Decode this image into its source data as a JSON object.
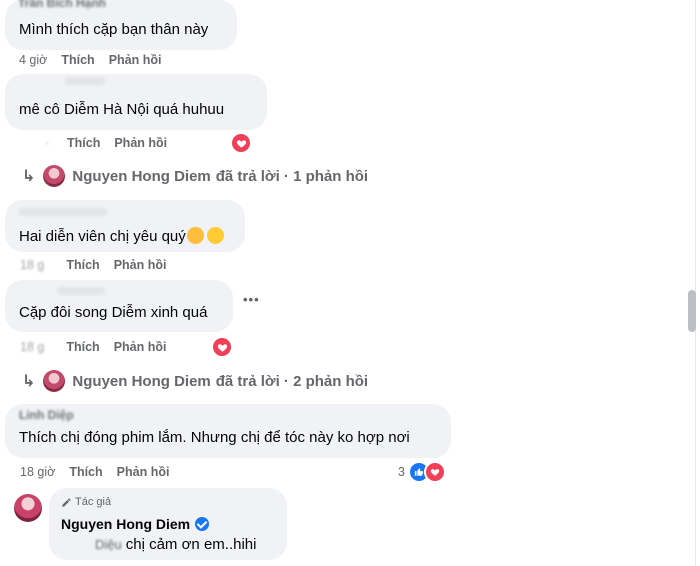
{
  "comments": [
    {
      "name": "Trần Bích Hạnh",
      "text": "Mình thích cặp bạn thân này",
      "time": "4 giờ"
    },
    {
      "name": "",
      "text": "mê cô Diễm Hà Nội quá huhuu",
      "time": "",
      "reaction": "love-icon"
    },
    {
      "name": "",
      "text": "Hai diễn viên chị yêu quý",
      "time": "18 g"
    },
    {
      "name": "",
      "text": "Cặp đôi song Diễm xinh quá",
      "time": "18 g",
      "reaction": "love-icon"
    },
    {
      "name": "Linh Diệp",
      "text": "Thích chị đóng phim lắm. Nhưng chị để tóc này ko hợp nơi",
      "time": "18 giờ",
      "reaction_count": "3"
    }
  ],
  "actions": {
    "like": "Thích",
    "reply": "Phản hồi"
  },
  "reply_threads": [
    {
      "author": "Nguyen Hong Diem",
      "suffix": "đã trả lời · 1 phản hồi"
    },
    {
      "author": "Nguyen Hong Diem",
      "suffix": "đã trả lời · 2 phản hồi"
    }
  ],
  "author_reply": {
    "badge": "Tác giả",
    "name": "Nguyen Hong Diem",
    "mention": "Diệu",
    "text": "chị cảm ơn em..hihi"
  },
  "more_options": "•••",
  "colors": {
    "bubble": "#f0f2f5",
    "meta": "#65676b",
    "love": "#f33e58",
    "like": "#1877f2"
  }
}
